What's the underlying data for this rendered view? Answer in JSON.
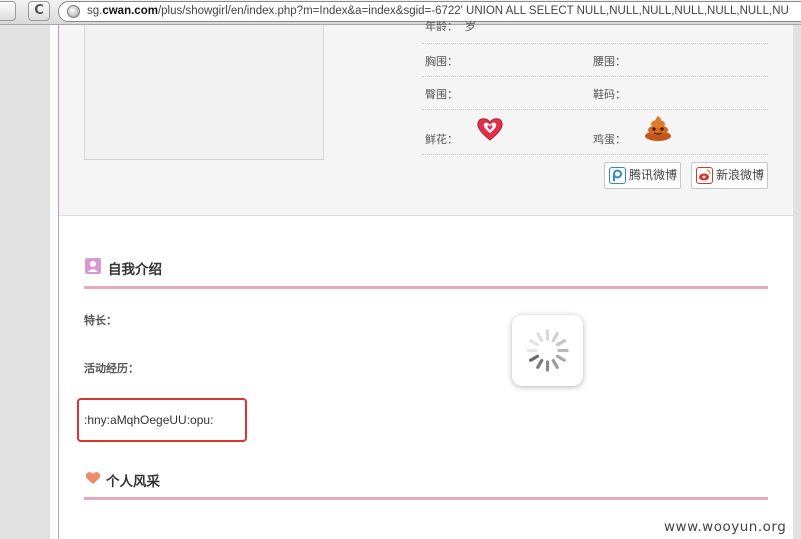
{
  "browser": {
    "back_label": "",
    "reload_label": "C",
    "url_prefix": "sg.",
    "url_domain": "cwan.com",
    "url_rest": "/plus/showgirl/en/index.php?m=Index&a=index&sgid=-6722' UNION ALL SELECT NULL,NULL,NULL,NULL,NULL,NULL,NU"
  },
  "profile": {
    "age_label": "年龄：",
    "age_value": "岁",
    "bust_label": "胸围：",
    "waist_label": "腰围：",
    "hips_label": "臀围：",
    "shoe_label": "鞋码：",
    "flower_label": "鲜花：",
    "egg_label": "鸡蛋：",
    "flower_icon": "heart-flower-icon",
    "egg_icon": "poop-egg-icon"
  },
  "share": {
    "tencent_label": "腾讯微博",
    "sina_label": "新浪微博"
  },
  "intro": {
    "title": "自我介绍",
    "specialty_label": "特长：",
    "experience_label": "活动经历：",
    "injected_output": ":hny:aMqhOegeUU:opu:"
  },
  "style_section": {
    "title": "个人风采"
  },
  "watermark": "www.wooyun.org",
  "colors": {
    "accent_pink": "#e9a7c0",
    "highlight_red": "#d9352e",
    "heart_icon": "#ef8a6e"
  }
}
